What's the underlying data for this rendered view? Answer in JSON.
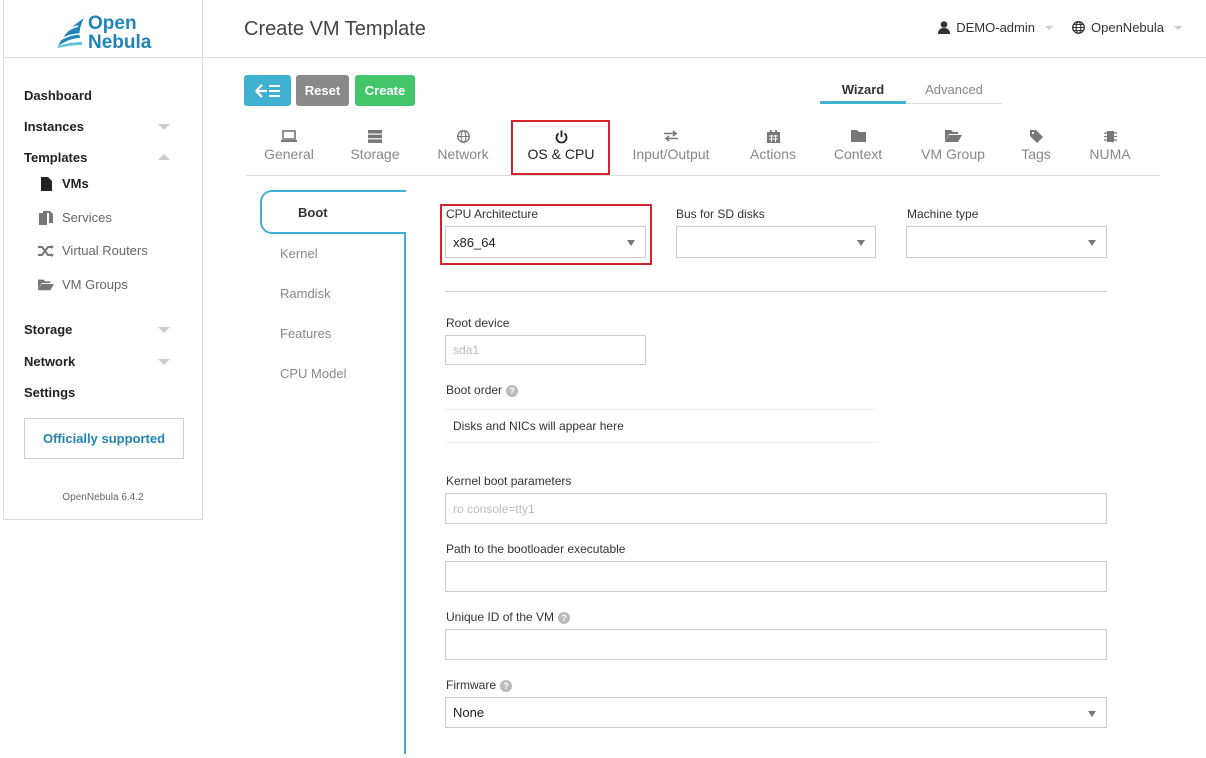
{
  "brand": {
    "line1": "Open",
    "line2": "Nebula"
  },
  "sidebar": {
    "items": [
      {
        "label": "Dashboard"
      },
      {
        "label": "Instances"
      },
      {
        "label": "Templates"
      },
      {
        "label": "Storage"
      },
      {
        "label": "Network"
      },
      {
        "label": "Settings"
      }
    ],
    "templates_sub": [
      {
        "label": "VMs",
        "icon": "file-icon"
      },
      {
        "label": "Services",
        "icon": "files-icon"
      },
      {
        "label": "Virtual Routers",
        "icon": "shuffle-icon"
      },
      {
        "label": "VM Groups",
        "icon": "folder-open-icon"
      }
    ],
    "support_label": "Officially supported",
    "version": "OpenNebula 6.4.2"
  },
  "header": {
    "title": "Create VM Template",
    "user": "DEMO-admin",
    "zone": "OpenNebula"
  },
  "toolbar": {
    "back_icon": "arrow-left-list-icon",
    "reset_label": "Reset",
    "create_label": "Create"
  },
  "modes": {
    "wizard": "Wizard",
    "advanced": "Advanced"
  },
  "tabs": [
    {
      "label": "General",
      "icon": "laptop-icon"
    },
    {
      "label": "Storage",
      "icon": "server-icon"
    },
    {
      "label": "Network",
      "icon": "globe-icon"
    },
    {
      "label": "OS & CPU",
      "icon": "power-icon"
    },
    {
      "label": "Input/Output",
      "icon": "exchange-icon"
    },
    {
      "label": "Actions",
      "icon": "calendar-icon"
    },
    {
      "label": "Context",
      "icon": "folder-icon"
    },
    {
      "label": "VM Group",
      "icon": "folder-open-icon"
    },
    {
      "label": "Tags",
      "icon": "tag-icon"
    },
    {
      "label": "NUMA",
      "icon": "chip-icon"
    }
  ],
  "subtabs": [
    "Boot",
    "Kernel",
    "Ramdisk",
    "Features",
    "CPU Model"
  ],
  "form": {
    "cpu_arch_label": "CPU Architecture",
    "cpu_arch_value": "x86_64",
    "bus_label": "Bus for SD disks",
    "bus_value": "",
    "machine_label": "Machine type",
    "machine_value": "",
    "root_device_label": "Root device",
    "root_device_placeholder": "sda1",
    "boot_order_label": "Boot order",
    "boot_order_text": "Disks and NICs will appear here",
    "kernel_params_label": "Kernel boot parameters",
    "kernel_params_placeholder": "ro console=tty1",
    "bootloader_label": "Path to the bootloader executable",
    "bootloader_value": "",
    "uuid_label": "Unique ID of the VM",
    "uuid_value": "",
    "firmware_label": "Firmware",
    "firmware_value": "None"
  },
  "colors": {
    "accent": "#41b1d2",
    "brand": "#1f84b6",
    "create": "#43c66b",
    "reset": "#8a8a8a",
    "highlight": "#d0252e"
  }
}
